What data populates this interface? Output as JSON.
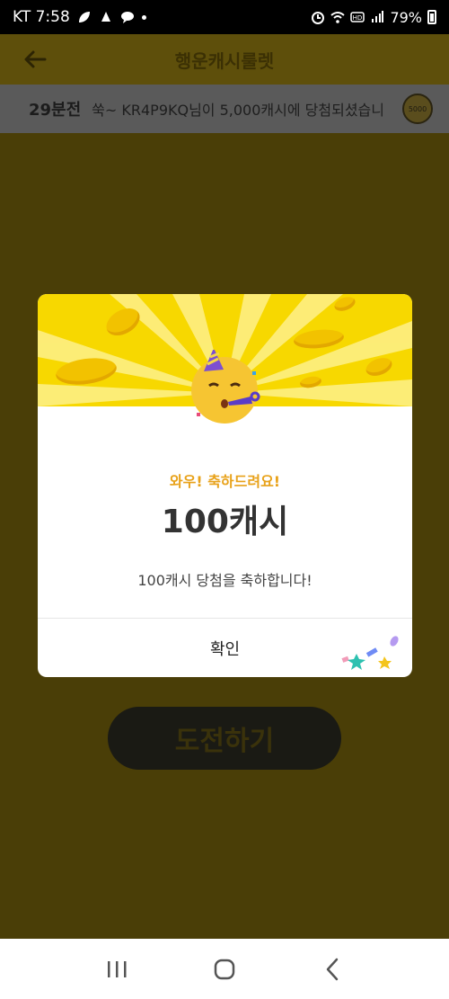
{
  "status_bar": {
    "carrier_time": "KT 7:58",
    "battery": "79%"
  },
  "header": {
    "title": "행운캐시룰렛"
  },
  "ticker": {
    "time": "29분전",
    "message": "쑥~ KR4P9KQ님이 5,000캐시에 당첨되셨습니",
    "badge": "5000"
  },
  "background": {
    "challenge_label": "도전하기"
  },
  "modal": {
    "subtitle": "와우! 축하드려요!",
    "amount": "100캐시",
    "message": "100캐시 당첨을 축하합니다!",
    "confirm_label": "확인"
  },
  "colors": {
    "modal_header": "#f7d800",
    "subtitle": "#e8a21a"
  }
}
